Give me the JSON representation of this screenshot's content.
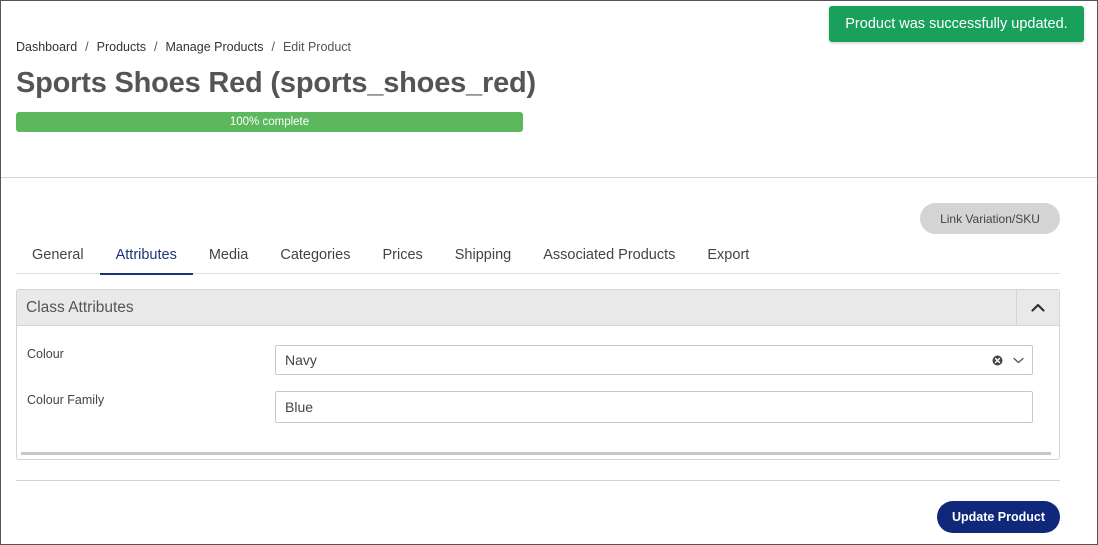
{
  "toast": {
    "message": "Product was successfully updated."
  },
  "breadcrumb": {
    "items": [
      "Dashboard",
      "Products",
      "Manage Products"
    ],
    "current": "Edit Product",
    "separator": "/"
  },
  "page": {
    "title": "Sports Shoes Red (sports_shoes_red)"
  },
  "progress": {
    "value_percent": 100,
    "label": "100% complete",
    "color": "#5cb85c"
  },
  "actions": {
    "link_variation": "Link Variation/SKU",
    "update": "Update Product"
  },
  "tabs": [
    {
      "label": "General"
    },
    {
      "label": "Attributes",
      "active": true
    },
    {
      "label": "Media"
    },
    {
      "label": "Categories"
    },
    {
      "label": "Prices"
    },
    {
      "label": "Shipping"
    },
    {
      "label": "Associated Products"
    },
    {
      "label": "Export"
    }
  ],
  "panel": {
    "title": "Class Attributes",
    "toggle_icon": "chevron-up-icon",
    "fields": {
      "colour": {
        "label": "Colour",
        "value": "Navy",
        "icons": [
          "clear-icon",
          "chevron-down-icon"
        ]
      },
      "colour_family": {
        "label": "Colour Family",
        "value": "Blue"
      }
    }
  },
  "colors": {
    "toast": "#19a05a",
    "accent": "#1c3577",
    "primary_button": "#10287a",
    "secondary_button": "#d4d4d4"
  }
}
